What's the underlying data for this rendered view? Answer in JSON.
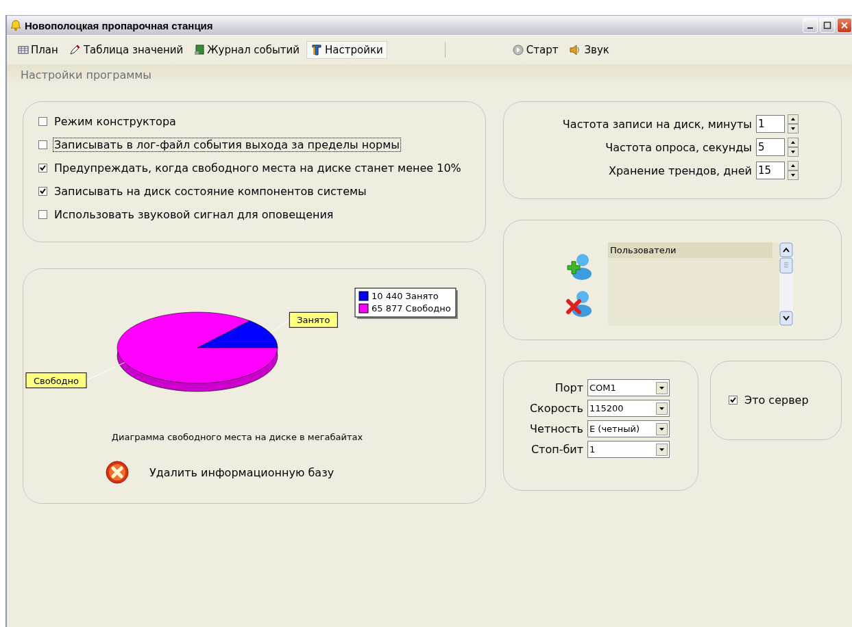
{
  "window": {
    "title": "Новополоцкая пропарочная станция"
  },
  "tabs": [
    {
      "label": "План",
      "selected": false
    },
    {
      "label": "Таблица значений",
      "selected": false
    },
    {
      "label": "Журнал событий",
      "selected": false
    },
    {
      "label": "Настройки",
      "selected": true
    }
  ],
  "actions": [
    {
      "label": "Старт"
    },
    {
      "label": "Звук"
    }
  ],
  "section_title": "Настройки программы",
  "options": [
    {
      "label": "Режим конструктора",
      "checked": false,
      "focused": false
    },
    {
      "label": "Записывать в лог-файл события выхода за пределы нормы",
      "checked": false,
      "focused": true
    },
    {
      "label": "Предупреждать, когда свободного места на диске станет менее 10%",
      "checked": true,
      "focused": false
    },
    {
      "label": "Записывать на диск состояние компонентов системы",
      "checked": true,
      "focused": false
    },
    {
      "label": "Использовать звуковой сигнал для оповещения",
      "checked": false,
      "focused": false
    }
  ],
  "disk_chart": {
    "chart_data": {
      "type": "pie",
      "title": "Диаграмма свободного места на диске в мегабайтах",
      "categories": [
        "Занято",
        "Свободно"
      ],
      "series": [
        {
          "values": [
            13.7,
            86.3
          ]
        }
      ]
    },
    "legend": [
      {
        "text": "10 440 Занято",
        "color": "#0000ff"
      },
      {
        "text": "65 877 Свободно",
        "color": "#ff00ff"
      }
    ]
  },
  "delete_button": {
    "label": "Удалить информационную базу"
  },
  "intervals": [
    {
      "label": "Частота записи на диск, минуты",
      "value": "1"
    },
    {
      "label": "Частота опроса, секунды",
      "value": "5"
    },
    {
      "label": "Хранение трендов, дней",
      "value": "15"
    }
  ],
  "users": {
    "header": "Пользователи"
  },
  "port_settings": [
    {
      "label": "Порт",
      "value": "COM1"
    },
    {
      "label": "Скорость",
      "value": "115200"
    },
    {
      "label": "Четность",
      "value": "E (четный)"
    },
    {
      "label": "Стоп-бит",
      "value": "1"
    }
  ],
  "server": {
    "label": "Это сервер",
    "checked": true
  }
}
